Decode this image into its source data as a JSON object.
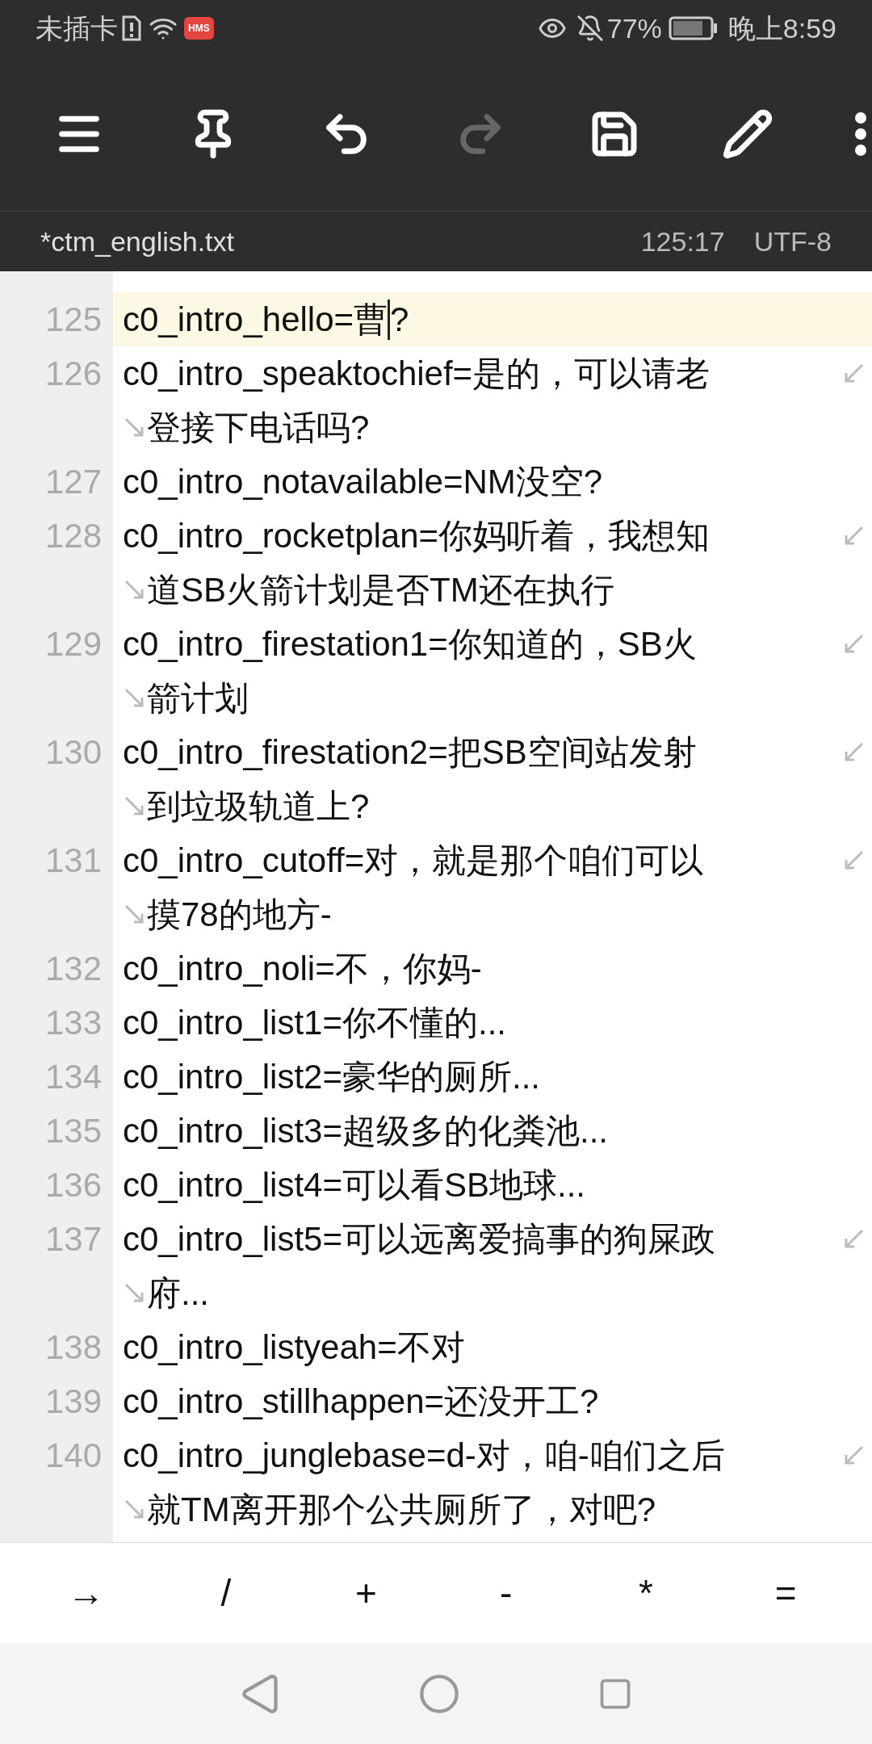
{
  "status_bar": {
    "carrier": "未插卡",
    "badge": "HMS",
    "battery": "77%",
    "time": "晚上8:59"
  },
  "toolbar": {
    "buttons": [
      {
        "kind": "menu",
        "disabled": false
      },
      {
        "kind": "pin",
        "disabled": false
      },
      {
        "kind": "undo",
        "disabled": false
      },
      {
        "kind": "redo",
        "disabled": true
      },
      {
        "kind": "save",
        "disabled": false
      },
      {
        "kind": "edit",
        "disabled": false
      },
      {
        "kind": "more",
        "disabled": false
      }
    ]
  },
  "file_bar": {
    "filename": "*ctm_english.txt",
    "position": "125:17",
    "encoding": "UTF-8"
  },
  "editor": {
    "lines": [
      {
        "number": "125",
        "current": true,
        "segments": [
          "c0_intro_hello=曹",
          "?"
        ]
      },
      {
        "number": "126",
        "current": false,
        "segments": [
          "c0_intro_speaktochief=是的，可以请老",
          "登接下电话吗?"
        ]
      },
      {
        "number": "127",
        "current": false,
        "segments": [
          "c0_intro_notavailable=NM没空?"
        ]
      },
      {
        "number": "128",
        "current": false,
        "segments": [
          "c0_intro_rocketplan=你妈听着，我想知",
          "道SB火箭计划是否TM还在执行"
        ]
      },
      {
        "number": "129",
        "current": false,
        "segments": [
          "c0_intro_firestation1=你知道的，SB火",
          "箭计划"
        ]
      },
      {
        "number": "130",
        "current": false,
        "segments": [
          "c0_intro_firestation2=把SB空间站发射",
          "到垃圾轨道上?"
        ]
      },
      {
        "number": "131",
        "current": false,
        "segments": [
          "c0_intro_cutoff=对，就是那个咱们可以",
          "摸78的地方-"
        ]
      },
      {
        "number": "132",
        "current": false,
        "segments": [
          "c0_intro_noli=不，你妈-"
        ]
      },
      {
        "number": "133",
        "current": false,
        "segments": [
          "c0_intro_list1=你不懂的..."
        ]
      },
      {
        "number": "134",
        "current": false,
        "segments": [
          "c0_intro_list2=豪华的厕所..."
        ]
      },
      {
        "number": "135",
        "current": false,
        "segments": [
          "c0_intro_list3=超级多的化粪池..."
        ]
      },
      {
        "number": "136",
        "current": false,
        "segments": [
          "c0_intro_list4=可以看SB地球..."
        ]
      },
      {
        "number": "137",
        "current": false,
        "segments": [
          "c0_intro_list5=可以远离爱搞事的狗屎政",
          "府..."
        ]
      },
      {
        "number": "138",
        "current": false,
        "segments": [
          "c0_intro_listyeah=不对"
        ]
      },
      {
        "number": "139",
        "current": false,
        "segments": [
          "c0_intro_stillhappen=还没开工?"
        ]
      },
      {
        "number": "140",
        "current": false,
        "segments": [
          "c0_intro_junglebase=d-对，咱-咱们之后",
          "就TM离开那个公共厕所了，对吧?"
        ]
      }
    ]
  },
  "symbol_keys": [
    "→",
    "/",
    "+",
    "-",
    "*",
    "="
  ]
}
